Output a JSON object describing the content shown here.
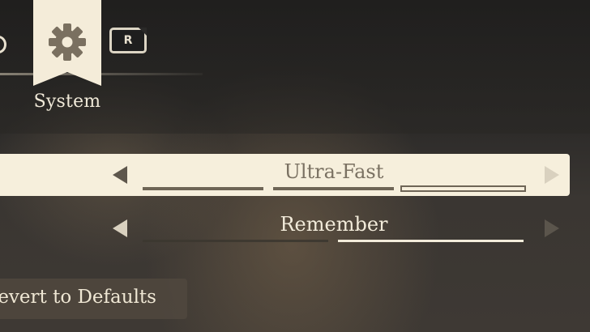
{
  "tabs": {
    "active_label": "System",
    "next_key_hint": "R"
  },
  "settings": [
    {
      "value": "Ultra-Fast",
      "selected_index": 2,
      "option_count": 3,
      "highlighted": true
    },
    {
      "value": "Remember",
      "selected_index": 1,
      "option_count": 2,
      "highlighted": false
    }
  ],
  "actions": {
    "revert_label": "Revert to Defaults"
  },
  "colors": {
    "cream": "#f6efdc",
    "dark_text": "#6e6556",
    "light_text": "#f0e9d8"
  }
}
